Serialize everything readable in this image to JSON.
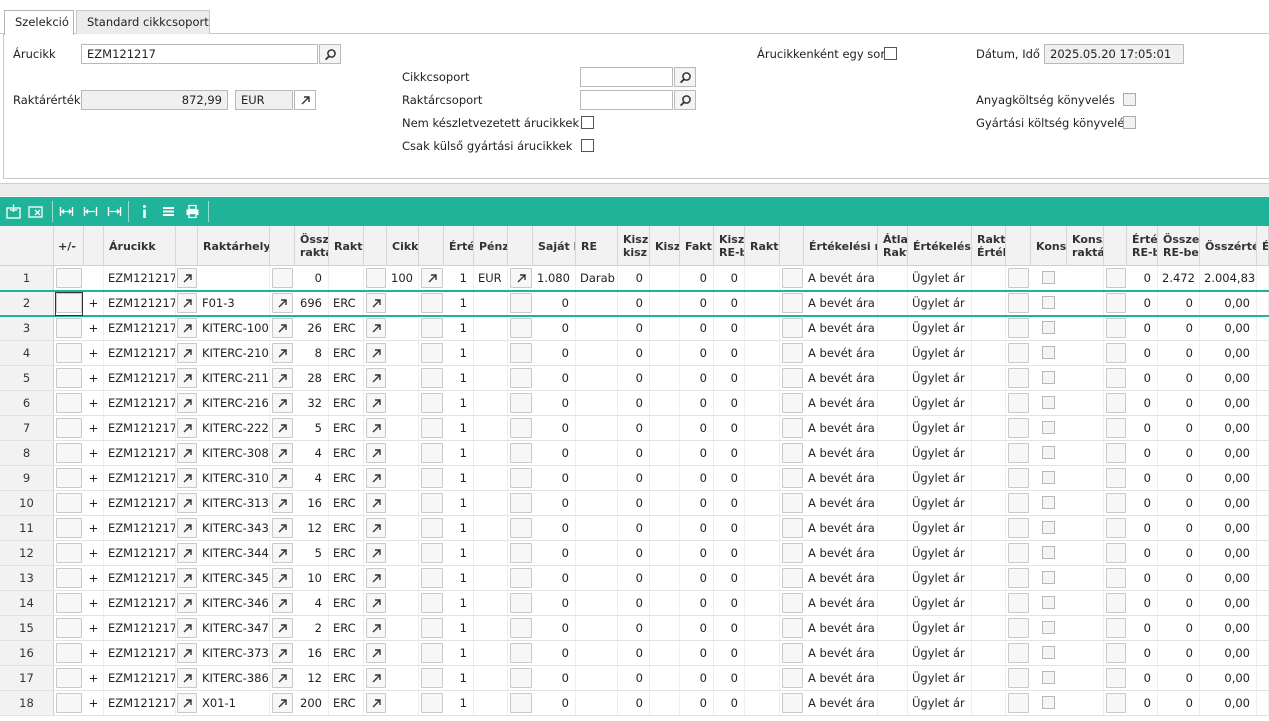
{
  "tabs": [
    {
      "label": "Szelekció",
      "active": true
    },
    {
      "label": "Standard cikkcsoport",
      "active": false
    }
  ],
  "form": {
    "arucikk_label": "Árucikk",
    "arucikk_value": "EZM121217",
    "raktarertek_label": "Raktárérték",
    "raktarertek_value": "872,99",
    "currency_value": "EUR",
    "cikkcsoport_label": "Cikkcsoport",
    "cikkcsoport_value": "",
    "raktarcsoport_label": "Raktárcsoport",
    "raktarcsoport_value": "",
    "nem_keszlet_label": "Nem készletvezetett árucikkek is",
    "csak_kulso_label": "Csak külső gyártási árucikkek",
    "arucikkenkent_label": "Árucikkenként egy sor",
    "datum_label": "Dátum, Idő",
    "datum_value": "2025.05.20 17:05:01",
    "anyagkoltseg_label": "Anyagköltség könyvelés",
    "gyartasi_label": "Gyártási költség könyvelés"
  },
  "toolbar": {
    "icons": [
      "add-row-icon",
      "delete-row-icon",
      "fit-columns-icon",
      "expand-columns-icon",
      "collapse-columns-icon",
      "info-icon",
      "menu-icon",
      "print-icon"
    ]
  },
  "columns": {
    "plusminus": "+/-",
    "arucikk": "Árucikk",
    "raktarhely": "Raktárhely",
    "ossz_raktar": "Össz raktá",
    "raktar": "Rakta",
    "cikk": "Cikk",
    "erte": "Érté",
    "penz": "Pénz",
    "sajat_re": "Saját k RE-be",
    "re": "RE",
    "kisz_kisz": "Kisz kisz",
    "kisz": "Kisz",
    "fakt": "Fakt",
    "kisz_re": "Kisz RE-b",
    "rakta2": "Rakta",
    "ertekelesi_m": "Értékelési m",
    "atlag_rakt": "Átla Rakt",
    "ertekelesi": "Értékelési",
    "rakta_ertek": "Rakta Érték",
    "konsz": "Konsz",
    "konsz_rakta": "Konsz raktá",
    "erte_re": "Érté RE-b",
    "osszeg_re": "Összeg RE-be",
    "osszerte": "Összérté",
    "e_last": "É"
  },
  "summary_row": {
    "num": "1",
    "arucikk": "EZM121217",
    "ossz": "0",
    "cikk": "100",
    "erte": "1",
    "penz": "EUR",
    "sajat": "1.080",
    "re": "Darab",
    "kisz_kisz": "0",
    "fakt": "0",
    "kisz_re": "0",
    "ertekelesi_m": "A bevét ára",
    "ertekelesi": "Ügylet ár",
    "erte_re": "0",
    "osszeg_re": "2.472",
    "osszerte": "2.004,83"
  },
  "rows": [
    {
      "num": "2",
      "pm": "+",
      "arucikk": "EZM121217",
      "raktarhely": "F01-3",
      "ossz": "696",
      "raktar": "ERC",
      "erte": "1",
      "sajat": "0",
      "kisz_kisz": "0",
      "fakt": "0",
      "kisz_re": "0",
      "ertekelesi_m": "A bevét ára",
      "ertekelesi": "Ügylet ár",
      "erte_re": "0",
      "osszeg_re": "0",
      "osszerte": "0,00"
    },
    {
      "num": "3",
      "pm": "+",
      "arucikk": "EZM121217",
      "raktarhely": "KITERC-100",
      "ossz": "26",
      "raktar": "ERC",
      "erte": "1",
      "sajat": "0",
      "kisz_kisz": "0",
      "fakt": "0",
      "kisz_re": "0",
      "ertekelesi_m": "A bevét ára",
      "ertekelesi": "Ügylet ár",
      "erte_re": "0",
      "osszeg_re": "0",
      "osszerte": "0,00"
    },
    {
      "num": "4",
      "pm": "+",
      "arucikk": "EZM121217",
      "raktarhely": "KITERC-210",
      "ossz": "8",
      "raktar": "ERC",
      "erte": "1",
      "sajat": "0",
      "kisz_kisz": "0",
      "fakt": "0",
      "kisz_re": "0",
      "ertekelesi_m": "A bevét ára",
      "ertekelesi": "Ügylet ár",
      "erte_re": "0",
      "osszeg_re": "0",
      "osszerte": "0,00"
    },
    {
      "num": "5",
      "pm": "+",
      "arucikk": "EZM121217",
      "raktarhely": "KITERC-211",
      "ossz": "28",
      "raktar": "ERC",
      "erte": "1",
      "sajat": "0",
      "kisz_kisz": "0",
      "fakt": "0",
      "kisz_re": "0",
      "ertekelesi_m": "A bevét ára",
      "ertekelesi": "Ügylet ár",
      "erte_re": "0",
      "osszeg_re": "0",
      "osszerte": "0,00"
    },
    {
      "num": "6",
      "pm": "+",
      "arucikk": "EZM121217",
      "raktarhely": "KITERC-216",
      "ossz": "32",
      "raktar": "ERC",
      "erte": "1",
      "sajat": "0",
      "kisz_kisz": "0",
      "fakt": "0",
      "kisz_re": "0",
      "ertekelesi_m": "A bevét ára",
      "ertekelesi": "Ügylet ár",
      "erte_re": "0",
      "osszeg_re": "0",
      "osszerte": "0,00"
    },
    {
      "num": "7",
      "pm": "+",
      "arucikk": "EZM121217",
      "raktarhely": "KITERC-222",
      "ossz": "5",
      "raktar": "ERC",
      "erte": "1",
      "sajat": "0",
      "kisz_kisz": "0",
      "fakt": "0",
      "kisz_re": "0",
      "ertekelesi_m": "A bevét ára",
      "ertekelesi": "Ügylet ár",
      "erte_re": "0",
      "osszeg_re": "0",
      "osszerte": "0,00"
    },
    {
      "num": "8",
      "pm": "+",
      "arucikk": "EZM121217",
      "raktarhely": "KITERC-308",
      "ossz": "4",
      "raktar": "ERC",
      "erte": "1",
      "sajat": "0",
      "kisz_kisz": "0",
      "fakt": "0",
      "kisz_re": "0",
      "ertekelesi_m": "A bevét ára",
      "ertekelesi": "Ügylet ár",
      "erte_re": "0",
      "osszeg_re": "0",
      "osszerte": "0,00"
    },
    {
      "num": "9",
      "pm": "+",
      "arucikk": "EZM121217",
      "raktarhely": "KITERC-310",
      "ossz": "4",
      "raktar": "ERC",
      "erte": "1",
      "sajat": "0",
      "kisz_kisz": "0",
      "fakt": "0",
      "kisz_re": "0",
      "ertekelesi_m": "A bevét ára",
      "ertekelesi": "Ügylet ár",
      "erte_re": "0",
      "osszeg_re": "0",
      "osszerte": "0,00"
    },
    {
      "num": "10",
      "pm": "+",
      "arucikk": "EZM121217",
      "raktarhely": "KITERC-313",
      "ossz": "16",
      "raktar": "ERC",
      "erte": "1",
      "sajat": "0",
      "kisz_kisz": "0",
      "fakt": "0",
      "kisz_re": "0",
      "ertekelesi_m": "A bevét ára",
      "ertekelesi": "Ügylet ár",
      "erte_re": "0",
      "osszeg_re": "0",
      "osszerte": "0,00"
    },
    {
      "num": "11",
      "pm": "+",
      "arucikk": "EZM121217",
      "raktarhely": "KITERC-343",
      "ossz": "12",
      "raktar": "ERC",
      "erte": "1",
      "sajat": "0",
      "kisz_kisz": "0",
      "fakt": "0",
      "kisz_re": "0",
      "ertekelesi_m": "A bevét ára",
      "ertekelesi": "Ügylet ár",
      "erte_re": "0",
      "osszeg_re": "0",
      "osszerte": "0,00"
    },
    {
      "num": "12",
      "pm": "+",
      "arucikk": "EZM121217",
      "raktarhely": "KITERC-344",
      "ossz": "5",
      "raktar": "ERC",
      "erte": "1",
      "sajat": "0",
      "kisz_kisz": "0",
      "fakt": "0",
      "kisz_re": "0",
      "ertekelesi_m": "A bevét ára",
      "ertekelesi": "Ügylet ár",
      "erte_re": "0",
      "osszeg_re": "0",
      "osszerte": "0,00"
    },
    {
      "num": "13",
      "pm": "+",
      "arucikk": "EZM121217",
      "raktarhely": "KITERC-345",
      "ossz": "10",
      "raktar": "ERC",
      "erte": "1",
      "sajat": "0",
      "kisz_kisz": "0",
      "fakt": "0",
      "kisz_re": "0",
      "ertekelesi_m": "A bevét ára",
      "ertekelesi": "Ügylet ár",
      "erte_re": "0",
      "osszeg_re": "0",
      "osszerte": "0,00"
    },
    {
      "num": "14",
      "pm": "+",
      "arucikk": "EZM121217",
      "raktarhely": "KITERC-346",
      "ossz": "4",
      "raktar": "ERC",
      "erte": "1",
      "sajat": "0",
      "kisz_kisz": "0",
      "fakt": "0",
      "kisz_re": "0",
      "ertekelesi_m": "A bevét ára",
      "ertekelesi": "Ügylet ár",
      "erte_re": "0",
      "osszeg_re": "0",
      "osszerte": "0,00"
    },
    {
      "num": "15",
      "pm": "+",
      "arucikk": "EZM121217",
      "raktarhely": "KITERC-347",
      "ossz": "2",
      "raktar": "ERC",
      "erte": "1",
      "sajat": "0",
      "kisz_kisz": "0",
      "fakt": "0",
      "kisz_re": "0",
      "ertekelesi_m": "A bevét ára",
      "ertekelesi": "Ügylet ár",
      "erte_re": "0",
      "osszeg_re": "0",
      "osszerte": "0,00"
    },
    {
      "num": "16",
      "pm": "+",
      "arucikk": "EZM121217",
      "raktarhely": "KITERC-373",
      "ossz": "16",
      "raktar": "ERC",
      "erte": "1",
      "sajat": "0",
      "kisz_kisz": "0",
      "fakt": "0",
      "kisz_re": "0",
      "ertekelesi_m": "A bevét ára",
      "ertekelesi": "Ügylet ár",
      "erte_re": "0",
      "osszeg_re": "0",
      "osszerte": "0,00"
    },
    {
      "num": "17",
      "pm": "+",
      "arucikk": "EZM121217",
      "raktarhely": "KITERC-386",
      "ossz": "12",
      "raktar": "ERC",
      "erte": "1",
      "sajat": "0",
      "kisz_kisz": "0",
      "fakt": "0",
      "kisz_re": "0",
      "ertekelesi_m": "A bevét ára",
      "ertekelesi": "Ügylet ár",
      "erte_re": "0",
      "osszeg_re": "0",
      "osszerte": "0,00"
    },
    {
      "num": "18",
      "pm": "+",
      "arucikk": "EZM121217",
      "raktarhely": "X01-1",
      "ossz": "200",
      "raktar": "ERC",
      "erte": "1",
      "sajat": "0",
      "kisz_kisz": "0",
      "fakt": "0",
      "kisz_re": "0",
      "ertekelesi_m": "A bevét ára",
      "ertekelesi": "Ügylet ár",
      "erte_re": "0",
      "osszeg_re": "0",
      "osszerte": "0,00"
    }
  ],
  "colors": {
    "accent": "#1fb39a",
    "header_bg": "#f2f2f2"
  }
}
